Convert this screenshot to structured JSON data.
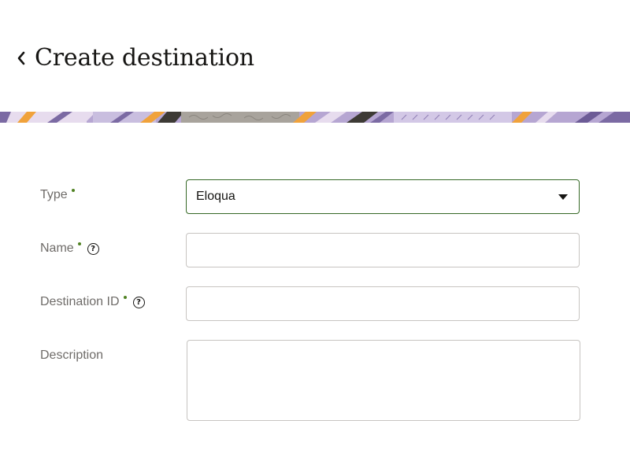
{
  "header": {
    "title": "Create destination",
    "back_icon": "chevron-left-icon"
  },
  "banner": {
    "colors": [
      "#7b6aa3",
      "#f0a23b",
      "#e7dcee",
      "#b6a6d2",
      "#3d3a35",
      "#a8a39c",
      "#6c5b96"
    ]
  },
  "form": {
    "type": {
      "label": "Type",
      "required": true,
      "value": "Eloqua"
    },
    "name": {
      "label": "Name",
      "required": true,
      "help_icon": "help-circle-icon",
      "value": "",
      "placeholder": ""
    },
    "destination_id": {
      "label": "Destination ID",
      "required": true,
      "help_icon": "help-circle-icon",
      "value": "",
      "placeholder": ""
    },
    "description": {
      "label": "Description",
      "required": false,
      "value": "",
      "placeholder": ""
    }
  },
  "colors": {
    "required_dot": "#508223",
    "focus_border": "#356825",
    "label": "#6f6c69"
  }
}
